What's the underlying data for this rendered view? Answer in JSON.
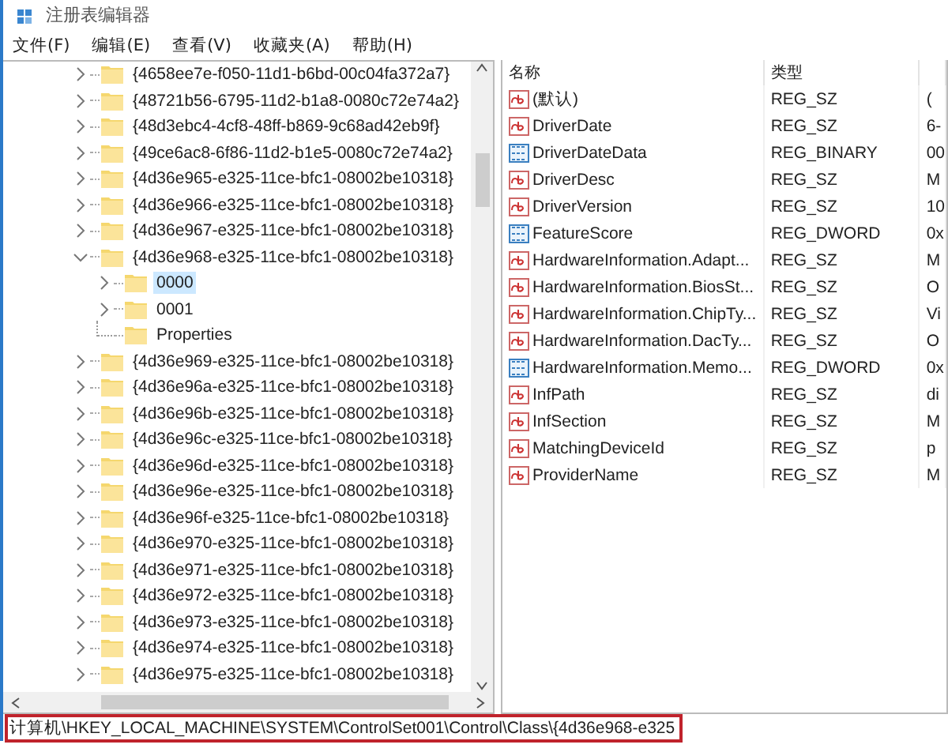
{
  "window": {
    "title": "注册表编辑器"
  },
  "menu": [
    "文件(F)",
    "编辑(E)",
    "查看(V)",
    "收藏夹(A)",
    "帮助(H)"
  ],
  "tree": [
    {
      "label": "{4658ee7e-f050-11d1-b6bd-00c04fa372a7}",
      "has_children": true,
      "expanded": false,
      "selected": false
    },
    {
      "label": "{48721b56-6795-11d2-b1a8-0080c72e74a2}",
      "has_children": true,
      "expanded": false,
      "selected": false
    },
    {
      "label": "{48d3ebc4-4cf8-48ff-b869-9c68ad42eb9f}",
      "has_children": true,
      "expanded": false,
      "selected": false
    },
    {
      "label": "{49ce6ac8-6f86-11d2-b1e5-0080c72e74a2}",
      "has_children": true,
      "expanded": false,
      "selected": false
    },
    {
      "label": "{4d36e965-e325-11ce-bfc1-08002be10318}",
      "has_children": true,
      "expanded": false,
      "selected": false
    },
    {
      "label": "{4d36e966-e325-11ce-bfc1-08002be10318}",
      "has_children": true,
      "expanded": false,
      "selected": false
    },
    {
      "label": "{4d36e967-e325-11ce-bfc1-08002be10318}",
      "has_children": true,
      "expanded": false,
      "selected": false
    },
    {
      "label": "{4d36e968-e325-11ce-bfc1-08002be10318}",
      "has_children": true,
      "expanded": true,
      "selected": false,
      "children": [
        {
          "label": "0000",
          "has_children": true,
          "expanded": false,
          "selected": true
        },
        {
          "label": "0001",
          "has_children": true,
          "expanded": false,
          "selected": false
        },
        {
          "label": "Properties",
          "has_children": false,
          "selected": false
        }
      ]
    },
    {
      "label": "{4d36e969-e325-11ce-bfc1-08002be10318}",
      "has_children": true,
      "expanded": false,
      "selected": false
    },
    {
      "label": "{4d36e96a-e325-11ce-bfc1-08002be10318}",
      "has_children": true,
      "expanded": false,
      "selected": false
    },
    {
      "label": "{4d36e96b-e325-11ce-bfc1-08002be10318}",
      "has_children": true,
      "expanded": false,
      "selected": false
    },
    {
      "label": "{4d36e96c-e325-11ce-bfc1-08002be10318}",
      "has_children": true,
      "expanded": false,
      "selected": false
    },
    {
      "label": "{4d36e96d-e325-11ce-bfc1-08002be10318}",
      "has_children": true,
      "expanded": false,
      "selected": false
    },
    {
      "label": "{4d36e96e-e325-11ce-bfc1-08002be10318}",
      "has_children": true,
      "expanded": false,
      "selected": false
    },
    {
      "label": "{4d36e96f-e325-11ce-bfc1-08002be10318}",
      "has_children": true,
      "expanded": false,
      "selected": false
    },
    {
      "label": "{4d36e970-e325-11ce-bfc1-08002be10318}",
      "has_children": true,
      "expanded": false,
      "selected": false
    },
    {
      "label": "{4d36e971-e325-11ce-bfc1-08002be10318}",
      "has_children": true,
      "expanded": false,
      "selected": false
    },
    {
      "label": "{4d36e972-e325-11ce-bfc1-08002be10318}",
      "has_children": true,
      "expanded": false,
      "selected": false
    },
    {
      "label": "{4d36e973-e325-11ce-bfc1-08002be10318}",
      "has_children": true,
      "expanded": false,
      "selected": false
    },
    {
      "label": "{4d36e974-e325-11ce-bfc1-08002be10318}",
      "has_children": true,
      "expanded": false,
      "selected": false
    },
    {
      "label": "{4d36e975-e325-11ce-bfc1-08002be10318}",
      "has_children": true,
      "expanded": false,
      "selected": false
    }
  ],
  "values": {
    "columns": [
      "名称",
      "类型"
    ],
    "rows": [
      {
        "kind": "string",
        "name": "(默认)",
        "type": "REG_SZ",
        "column_3": "("
      },
      {
        "kind": "string",
        "name": "DriverDate",
        "type": "REG_SZ",
        "column_3": "6-"
      },
      {
        "kind": "binary",
        "name": "DriverDateData",
        "type": "REG_BINARY",
        "column_3": "00"
      },
      {
        "kind": "string",
        "name": "DriverDesc",
        "type": "REG_SZ",
        "column_3": "M"
      },
      {
        "kind": "string",
        "name": "DriverVersion",
        "type": "REG_SZ",
        "column_3": "10"
      },
      {
        "kind": "binary",
        "name": "FeatureScore",
        "type": "REG_DWORD",
        "column_3": "0x"
      },
      {
        "kind": "string",
        "name": "HardwareInformation.Adapt...",
        "type": "REG_SZ",
        "column_3": "M"
      },
      {
        "kind": "string",
        "name": "HardwareInformation.BiosSt...",
        "type": "REG_SZ",
        "column_3": "O"
      },
      {
        "kind": "string",
        "name": "HardwareInformation.ChipTy...",
        "type": "REG_SZ",
        "column_3": "Vi"
      },
      {
        "kind": "string",
        "name": "HardwareInformation.DacTy...",
        "type": "REG_SZ",
        "column_3": "O"
      },
      {
        "kind": "binary",
        "name": "HardwareInformation.Memo...",
        "type": "REG_DWORD",
        "column_3": "0x"
      },
      {
        "kind": "string",
        "name": "InfPath",
        "type": "REG_SZ",
        "column_3": "di"
      },
      {
        "kind": "string",
        "name": "InfSection",
        "type": "REG_SZ",
        "column_3": "M"
      },
      {
        "kind": "string",
        "name": "MatchingDeviceId",
        "type": "REG_SZ",
        "column_3": "p"
      },
      {
        "kind": "string",
        "name": "ProviderName",
        "type": "REG_SZ",
        "column_3": "M"
      }
    ]
  },
  "status_bar": {
    "path": "计算机\\HKEY_LOCAL_MACHINE\\SYSTEM\\ControlSet001\\Control\\Class\\{4d36e968-e325",
    "highlighted": true
  }
}
